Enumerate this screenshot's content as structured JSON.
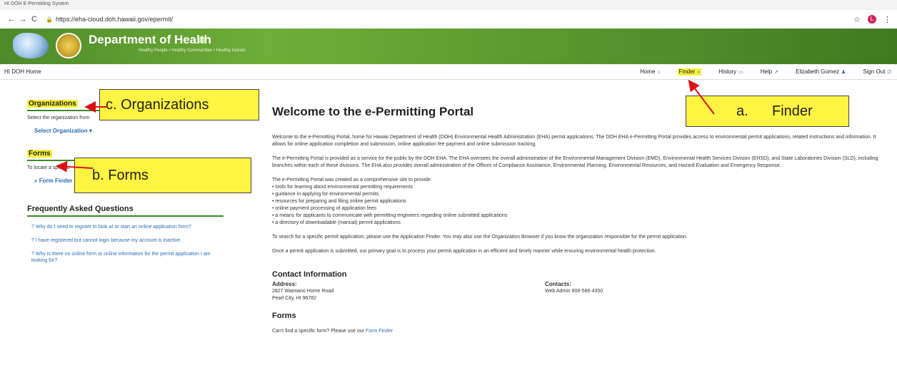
{
  "browser": {
    "tab_title": "HI DOH E-Permitting System",
    "url": "https://eha-cloud.doh.hawaii.gov/epermit/",
    "avatar_letter": "L"
  },
  "banner": {
    "title": "Department of Health",
    "tagline": "Healthy People • Healthy Communities • Healthy Islands"
  },
  "menubar": {
    "home_left": "HI DOH Home",
    "items": [
      "Home",
      "Finder",
      "History",
      "Help",
      "Elizabeth Gomez",
      "Sign Out"
    ]
  },
  "sidebar": {
    "organizations": {
      "title": "Organizations",
      "desc": "Select the organization from",
      "link": "Select Organization"
    },
    "forms": {
      "title": "Forms",
      "desc": "To locate a specific",
      "link": "Form Finder"
    },
    "faq": {
      "title": "Frequently Asked Questions",
      "items": [
        "? Why do I need to register to look at or start an online application form?",
        "? I have registered but cannot login because my account is inactive.",
        "? Why is there no online form or online information for the permit application I am looking for?"
      ]
    }
  },
  "callouts": {
    "organizations": "c. Organizations",
    "forms": "b. Forms",
    "finder": "a.      Finder"
  },
  "main": {
    "heading": "Welcome to the e-Permitting Portal",
    "p1": "Welcome to the e-Permitting Portal, home for Hawaii Department of Health (DOH) Environmental Health Administration (EHA) permit applications. The DOH EHA e-Permitting Portal provides access to environmental permit applications, related instructions and information. It allows for online application completion and submission, online application fee payment and online submission tracking.",
    "p2": "The e-Permitting Portal is provided as a service for the public by the DOH EHA. The EHA oversees the overall administration of the Environmental Management Division (EMD), Environmental Health Services Division (EHSD), and State Laboratories Division (SLD), including branches within each of these divisions. The EHA also provides overall administration of the Offices of Compliance Assistance, Environmental Planning, Environmental Resources, and Hazard Evaluation and Emergency Response.",
    "p3_intro": "The e-Permitting Portal was created as a comprehensive site to provide:",
    "bullets": [
      "• tools for learning about environmental permitting requirements",
      "• guidance in applying for environmental permits",
      "• resources for preparing and filing online permit applications",
      "• online payment processing of application fees",
      "• a means for applicants to communicate with permitting engineers regarding online submitted applications",
      "• a directory of downloadable (manual) permit applications"
    ],
    "p4": "To search for a specific permit application, please use the Application Finder. You may also use the Organization Browser if you know the organization responsible for the permit application.",
    "p5": "Once a permit application is submitted, our primary goal is to process your permit application in an efficient and timely manner while ensuring environmental health protection.",
    "contact": {
      "title": "Contact Information",
      "address_label": "Address:",
      "address_line1": "2827 Waimano Home Road",
      "address_line2": "Pearl City, HI 96782",
      "contacts_label": "Contacts:",
      "contacts_line1": "Web Admin  808-586-4350"
    },
    "forms": {
      "title": "Forms",
      "text": "Can't find a specific form? Please use our",
      "link": "Form Finder"
    }
  }
}
